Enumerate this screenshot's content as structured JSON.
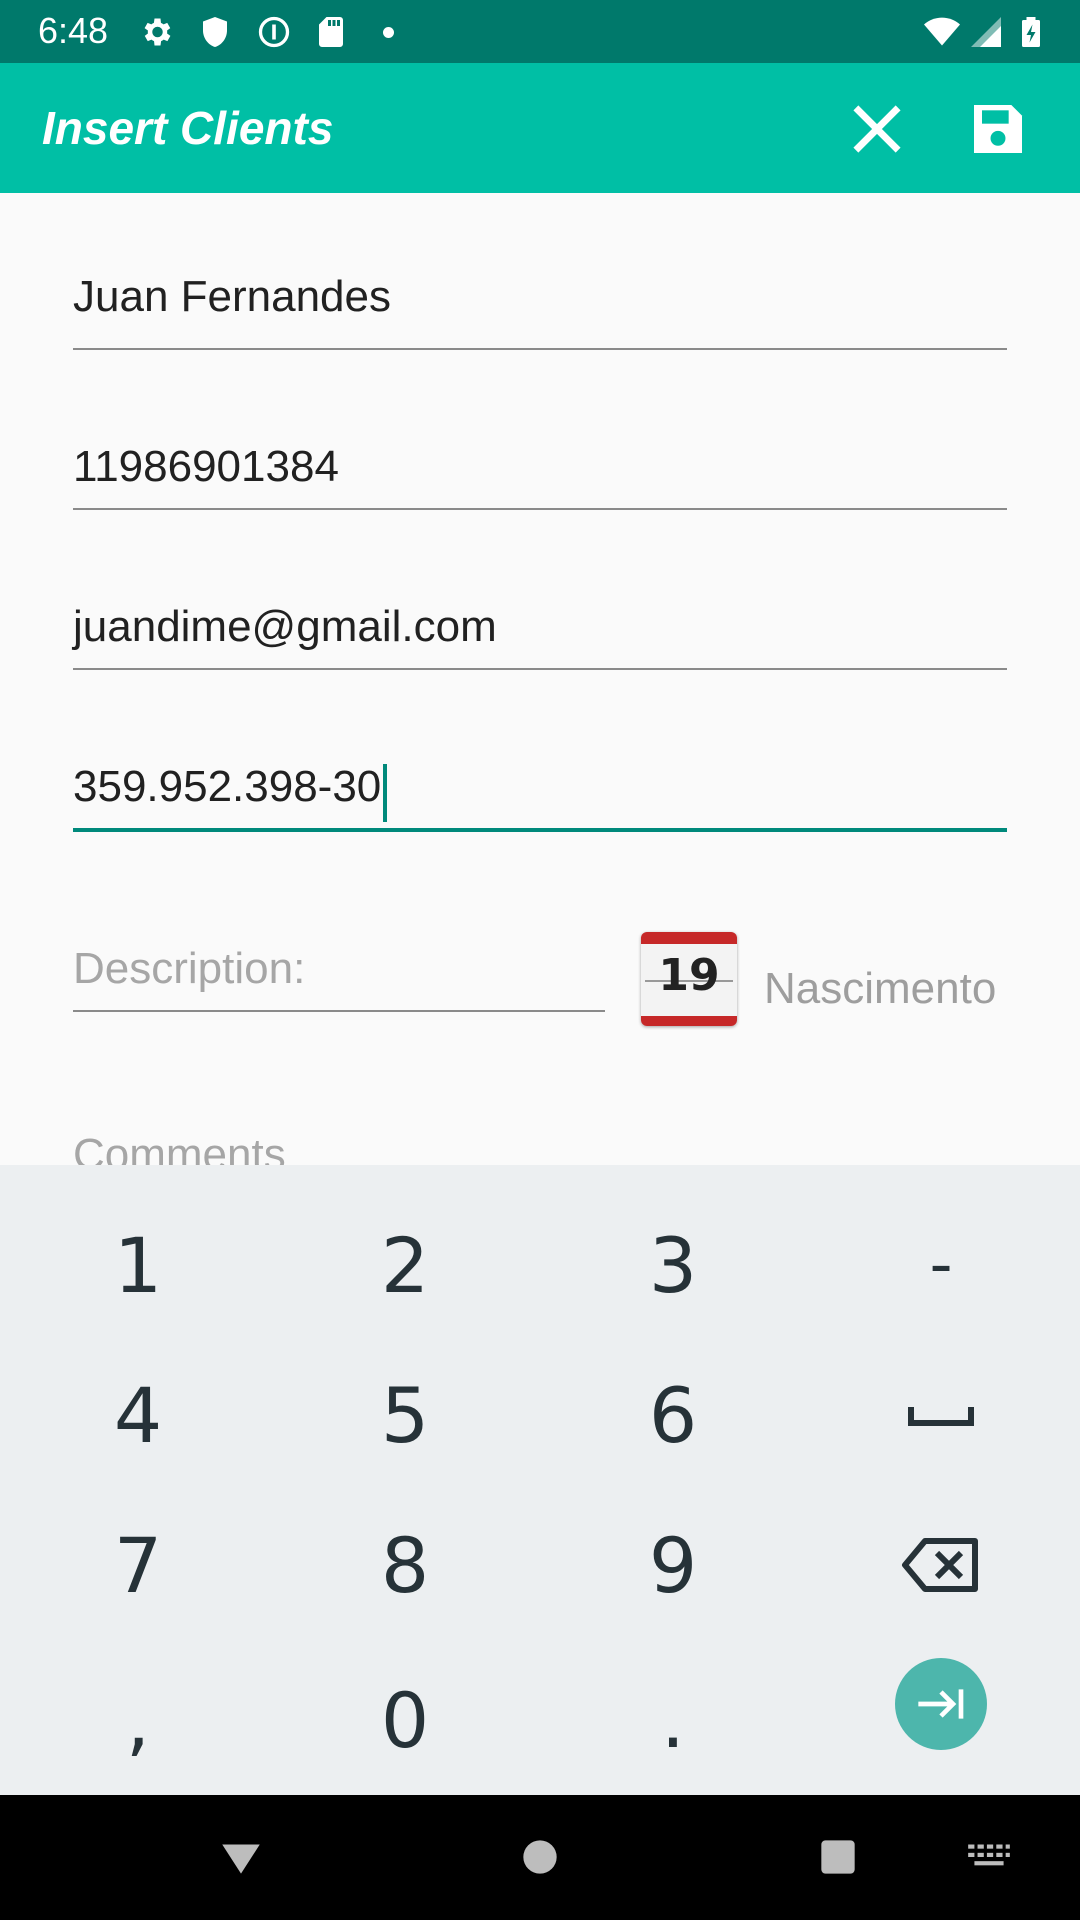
{
  "status_bar": {
    "time": "6:48",
    "icons": [
      "settings-icon",
      "shield-icon",
      "info-icon",
      "sd-card-icon",
      "notification-dot-icon",
      "wifi-icon",
      "cell-signal-icon",
      "battery-icon"
    ]
  },
  "app_bar": {
    "title": "Insert Clients",
    "close_icon": "close-icon",
    "save_icon": "save-icon"
  },
  "form": {
    "name_value": "Juan Fernandes",
    "phone_value": "11986901384",
    "email_value": "juandime@gmail.com",
    "cpf_value": "359.952.398-30",
    "description_placeholder": "Description:",
    "calendar_day": "19",
    "birth_label": "Nascimento",
    "comments_placeholder": "Comments"
  },
  "keyboard": {
    "row1": [
      "1",
      "2",
      "3",
      "-"
    ],
    "row2": [
      "4",
      "5",
      "6"
    ],
    "row3": [
      "7",
      "8",
      "9"
    ],
    "row4": [
      ",",
      "0",
      "."
    ],
    "space_icon": "space-icon",
    "backspace_icon": "backspace-icon",
    "enter_icon": "next-field-icon"
  },
  "colors": {
    "status_bar": "#00796b",
    "app_bar": "#00bfa5",
    "accent": "#00897b",
    "keyboard_bg": "#eceff1",
    "enter_key": "#4db6ac"
  }
}
